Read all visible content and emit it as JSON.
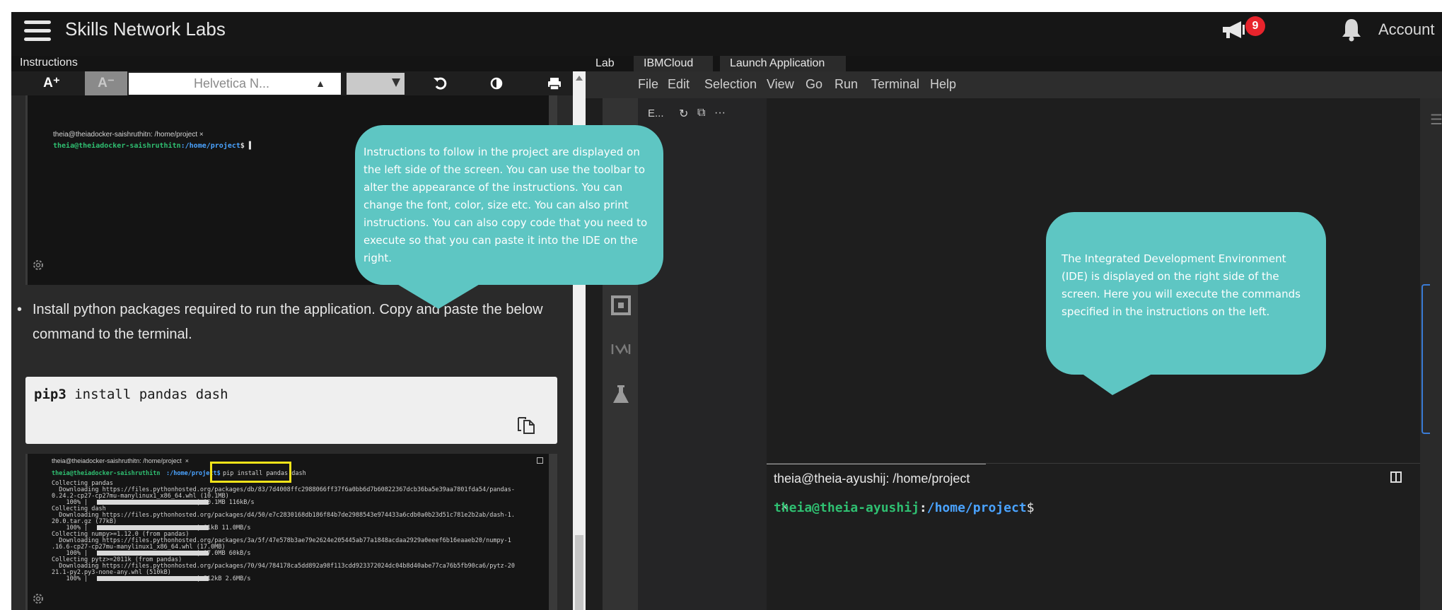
{
  "topbar": {
    "brand": "Skills Network Labs",
    "notification_count": "9",
    "account_label": "Account"
  },
  "left_panel": {
    "tab": "Instructions",
    "toolbar": {
      "increase_font": "A⁺",
      "decrease_font": "A⁻",
      "font_value": "Helvetica N...",
      "reset_icon": "undo-icon",
      "contrast_icon": "contrast-icon",
      "print_icon": "print-icon"
    },
    "screenshot1": {
      "tab_title": "theia@theiadocker-saishruthitn: /home/project  ×",
      "prompt_user": "theia@theiadocker-saishruthitn",
      "prompt_path": ":/home/project",
      "prompt_end": "$ ▌"
    },
    "bullet_text": "Install python packages required to run the application. Copy and paste the below command to the terminal.",
    "code": {
      "command": "pip3",
      "args": " install pandas dash"
    },
    "screenshot2": {
      "tab_title": "theia@theiadocker-saishruthitn: /home/project  ×",
      "prompt_user": "theia@theiadocker-saishruthitn",
      "prompt_path": ":/home/project$",
      "command": "pip install pandas dash",
      "lines": [
        "Collecting pandas",
        "  Downloading https://files.pythonhosted.org/packages/db/83/7d4008ffc2988066ff37f6a0bb6d7b60822367dcb36ba5e39aa7801fda54/pandas-",
        "0.24.2-cp27-cp27mu-manylinux1_x86_64.whl (10.1MB)",
        "    100% |                              | 10.1MB 116kB/s",
        "Collecting dash",
        "  Downloading https://files.pythonhosted.org/packages/d4/50/e7c2830168db186f84b7de2988543e974433a6cdb0a0b23d51c781e2b2ab/dash-1.",
        "20.0.tar.gz (77kB)",
        "    100% |                              | 81kB 11.0MB/s",
        "Collecting numpy>=1.12.0 (from pandas)",
        "  Downloading https://files.pythonhosted.org/packages/3a/5f/47e578b3ae79e2624e205445ab77a1848acdaa2929a0eeef6b16eaaeb20/numpy-1",
        ".16.6-cp27-cp27mu-manylinux1_x86_64.whl (17.0MB)",
        "    100% |                              | 17.0MB 60kB/s",
        "Collecting pytz>=2011k (from pandas)",
        "  Downloading https://files.pythonhosted.org/packages/70/94/784178ca5dd892a98f113cdd923372024dc04b8d40abe77ca76b5fb90ca6/pytz-20",
        "21.1-py2.py3-none-any.whl (510kB)",
        "    100% |                              | 512kB 2.6MB/s"
      ]
    }
  },
  "bubbles": {
    "left": "Instructions to follow in the project are displayed on the left side of the screen. You can use the toolbar to alter the appearance of the instructions. You can change the font, color, size etc. You can also print instructions. You can also copy code that you need to execute so that you can paste it into the IDE on the right.",
    "right": "The Integrated Development Environment (IDE) is displayed on the right side of the screen. Here you will execute the commands specified in the instructions on the left."
  },
  "right_panel": {
    "tabs": [
      "Lab",
      "IBMCloud",
      "Launch Application"
    ],
    "menu": [
      "File",
      "Edit",
      "Selection",
      "View",
      "Go",
      "Run",
      "Terminal",
      "Help"
    ],
    "explorer_label": "E...",
    "terminal": {
      "tab_title": "theia@theia-ayushij: /home/project",
      "close": "×",
      "prompt_user": "theia@theia-ayushij",
      "prompt_sep": ":",
      "prompt_path": "/home/project",
      "prompt_end": "$"
    }
  },
  "colors": {
    "bubble": "#5ec6c3",
    "badge": "#e8242c",
    "highlight": "#f4e41a",
    "terminal_green": "#2fbf71",
    "terminal_blue": "#4aa3ff"
  }
}
